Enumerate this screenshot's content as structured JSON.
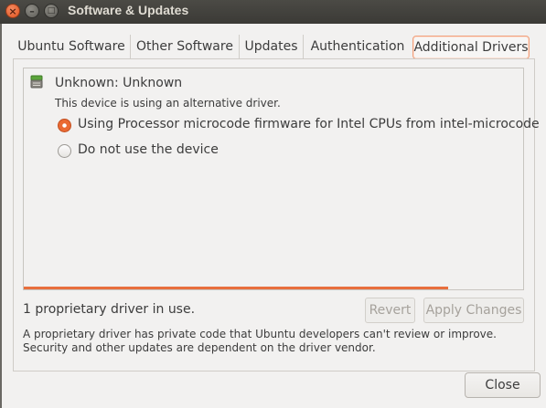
{
  "window": {
    "title": "Software & Updates"
  },
  "window_controls": {
    "close_glyph": "×",
    "minimize_glyph": "–",
    "maximize_glyph": "□"
  },
  "tabs": [
    {
      "label": "Ubuntu Software"
    },
    {
      "label": "Other Software"
    },
    {
      "label": "Updates"
    },
    {
      "label": "Authentication"
    },
    {
      "label": "Additional Drivers",
      "active": true
    }
  ],
  "device": {
    "icon": "chip-icon",
    "name": "Unknown: Unknown",
    "description": "This device is using an alternative driver.",
    "options": [
      {
        "label": "Using Processor microcode firmware for Intel CPUs from intel-microcode",
        "selected": true
      },
      {
        "label": "Do not use the device",
        "selected": false
      }
    ]
  },
  "progress": {
    "fraction": 0.85,
    "color": "#e86f3d"
  },
  "status": {
    "text": "1 proprietary driver in use."
  },
  "buttons": {
    "revert": "Revert",
    "apply": "Apply Changes",
    "close": "Close"
  },
  "note": {
    "text": "A proprietary driver has private code that Ubuntu developers can't review or improve. Security and other updates are dependent on the driver vendor."
  },
  "colors": {
    "accent": "#e86f3d",
    "titlebar": "#3c3b37"
  }
}
